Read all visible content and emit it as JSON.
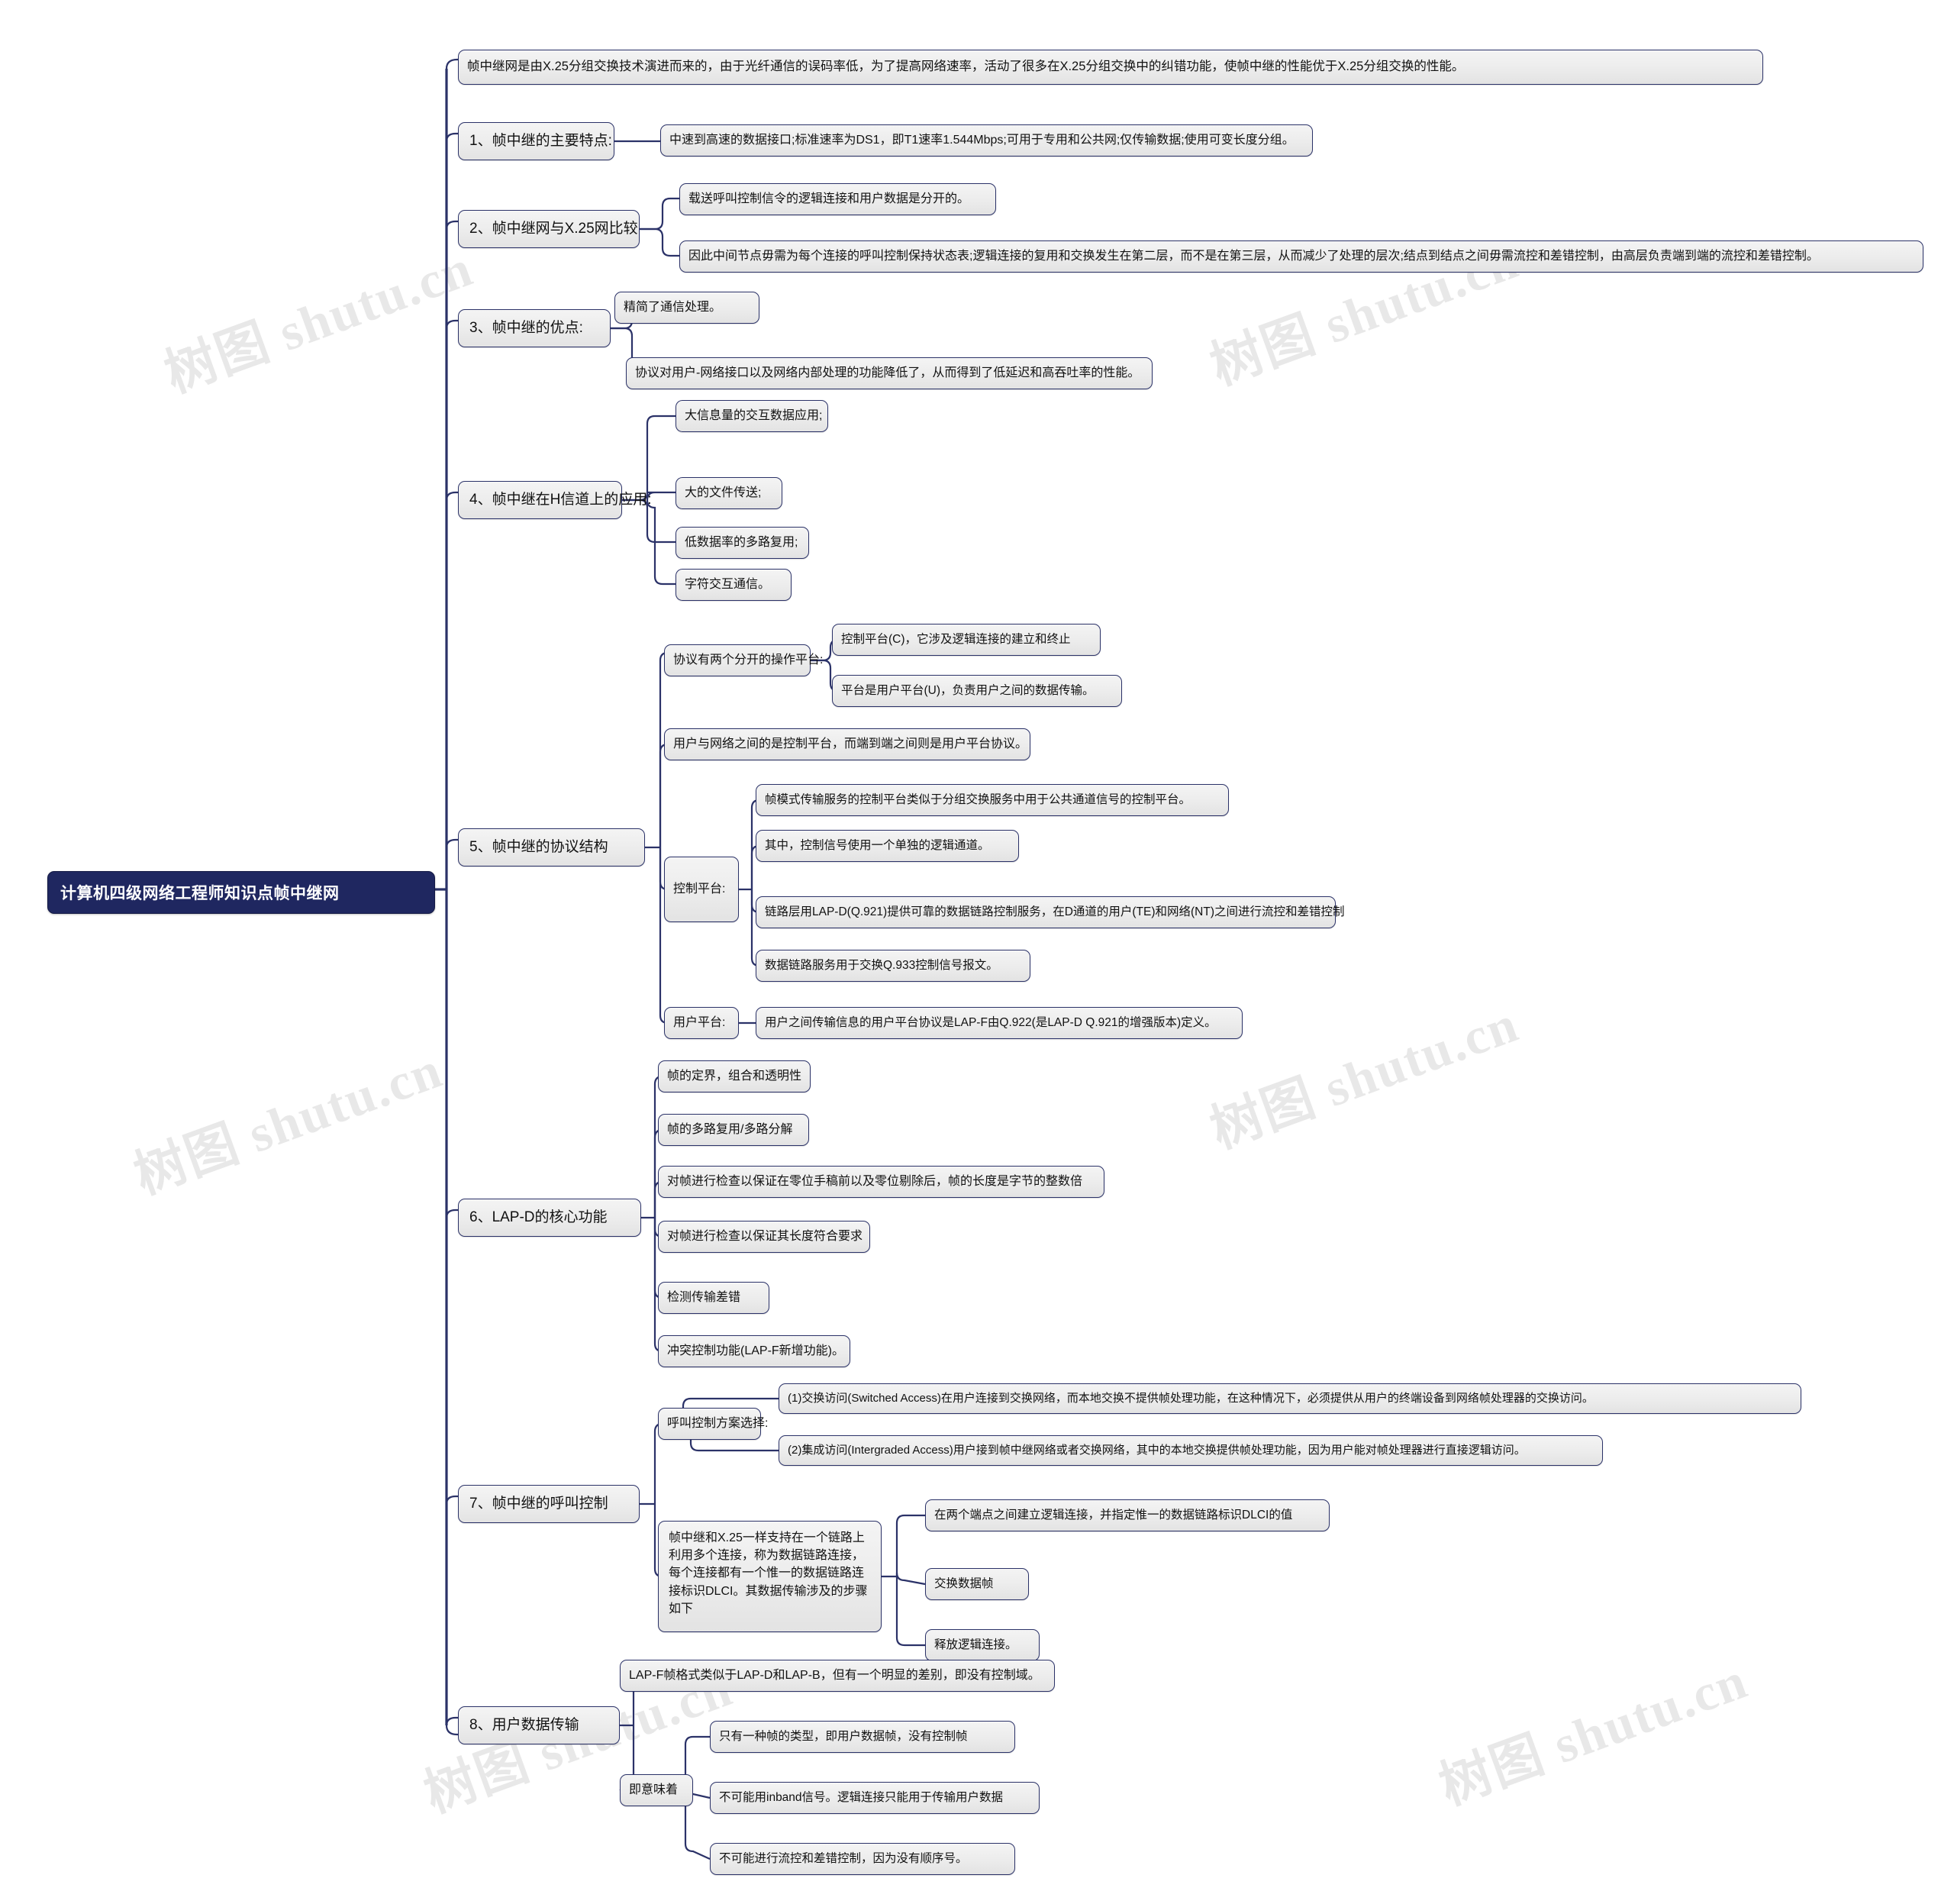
{
  "theme": {
    "root_bg": "#1f2760",
    "root_text": "#ffffff",
    "node_bg": "#ececec",
    "node_border": "#2b3268",
    "node_text": "#111111",
    "link_color": "#2b3268",
    "canvas_bg": "#ffffff"
  },
  "watermark": {
    "text": "树图 shutu.cn"
  },
  "root": {
    "label": "计算机四级网络工程师知识点帧中继网"
  },
  "nodes": {
    "intro": "帧中继网是由X.25分组交换技术演进而来的，由于光纤通信的误码率低，为了提高网络速率，活动了很多在X.25分组交换中的纠错功能，使帧中继的性能优于X.25分组交换的性能。",
    "b1": {
      "label": "1、帧中继的主要特点:",
      "children": [
        "中速到高速的数据接口;标准速率为DS1，即T1速率1.544Mbps;可用于专用和公共网;仅传输数据;使用可变长度分组。"
      ]
    },
    "b2": {
      "label": "2、帧中继网与X.25网比较",
      "children": [
        "载送呼叫控制信令的逻辑连接和用户数据是分开的。",
        "因此中间节点毋需为每个连接的呼叫控制保持状态表;逻辑连接的复用和交换发生在第二层，而不是在第三层，从而减少了处理的层次;结点到结点之间毋需流控和差错控制，由高层负责端到端的流控和差错控制。"
      ]
    },
    "b3": {
      "label": "3、帧中继的优点:",
      "children": [
        "精简了通信处理。",
        "协议对用户-网络接口以及网络内部处理的功能降低了，从而得到了低延迟和高吞吐率的性能。"
      ]
    },
    "b4": {
      "label": "4、帧中继在H信道上的应用:",
      "children": [
        "大信息量的交互数据应用;",
        "大的文件传送;",
        "低数据率的多路复用;",
        "字符交互通信。"
      ]
    },
    "b5": {
      "label": "5、帧中继的协议结构",
      "c1": {
        "label": "协议有两个分开的操作平台:",
        "children": [
          "控制平台(C)，它涉及逻辑连接的建立和终止",
          "平台是用户平台(U)，负责用户之间的数据传输。"
        ]
      },
      "c2": "用户与网络之间的是控制平台，而端到端之间则是用户平台协议。",
      "c3": {
        "label": "控制平台:",
        "children": [
          "帧模式传输服务的控制平台类似于分组交换服务中用于公共通道信号的控制平台。",
          "其中，控制信号使用一个单独的逻辑通道。",
          "链路层用LAP-D(Q.921)提供可靠的数据链路控制服务，在D通道的用户(TE)和网络(NT)之间进行流控和差错控制",
          "数据链路服务用于交换Q.933控制信号报文。"
        ]
      },
      "c4": {
        "label": "用户平台:",
        "children": [
          "用户之间传输信息的用户平台协议是LAP-F由Q.922(是LAP-D Q.921的增强版本)定义。"
        ]
      }
    },
    "b6": {
      "label": "6、LAP-D的核心功能",
      "children": [
        "帧的定界，组合和透明性",
        "帧的多路复用/多路分解",
        "对帧进行检查以保证在零位手稿前以及零位剔除后，帧的长度是字节的整数倍",
        "对帧进行检查以保证其长度符合要求",
        "检测传输差错",
        "冲突控制功能(LAP-F新增功能)。"
      ]
    },
    "b7": {
      "label": "7、帧中继的呼叫控制",
      "c1": {
        "label": "呼叫控制方案选择:",
        "children": [
          "(1)交换访问(Switched Access)在用户连接到交换网络，而本地交换不提供帧处理功能，在这种情况下，必须提供从用户的终端设备到网络帧处理器的交换访问。",
          "(2)集成访问(Intergraded Access)用户接到帧中继网络或者交换网络，其中的本地交换提供帧处理功能，因为用户能对帧处理器进行直接逻辑访问。"
        ]
      },
      "c2": {
        "label": "帧中继和X.25一样支持在一个链路上利用多个连接，称为数据链路连接，每个连接都有一个惟一的数据链路连接标识DLCI。其数据传输涉及的步骤如下",
        "children": [
          "在两个端点之间建立逻辑连接，并指定惟一的数据链路标识DLCI的值",
          "交换数据帧",
          "释放逻辑连接。"
        ]
      }
    },
    "b8": {
      "label": "8、用户数据传输",
      "c1": "LAP-F帧格式类似于LAP-D和LAP-B，但有一个明显的差别，即没有控制域。",
      "c2": {
        "label": "即意味着",
        "children": [
          "只有一种帧的类型，即用户数据帧，没有控制帧",
          "不可能用inband信号。逻辑连接只能用于传输用户数据",
          "不可能进行流控和差错控制，因为没有顺序号。"
        ]
      }
    }
  }
}
